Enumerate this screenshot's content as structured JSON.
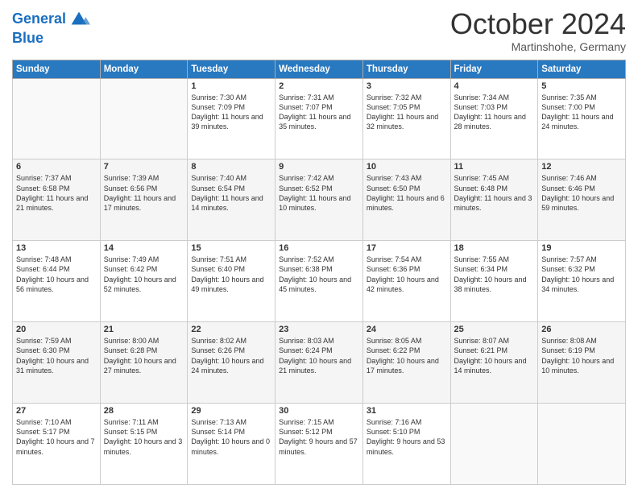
{
  "header": {
    "logo_line1": "General",
    "logo_line2": "Blue",
    "month": "October 2024",
    "location": "Martinshohe, Germany"
  },
  "weekdays": [
    "Sunday",
    "Monday",
    "Tuesday",
    "Wednesday",
    "Thursday",
    "Friday",
    "Saturday"
  ],
  "weeks": [
    [
      {
        "day": "",
        "info": ""
      },
      {
        "day": "",
        "info": ""
      },
      {
        "day": "1",
        "info": "Sunrise: 7:30 AM\nSunset: 7:09 PM\nDaylight: 11 hours and 39 minutes."
      },
      {
        "day": "2",
        "info": "Sunrise: 7:31 AM\nSunset: 7:07 PM\nDaylight: 11 hours and 35 minutes."
      },
      {
        "day": "3",
        "info": "Sunrise: 7:32 AM\nSunset: 7:05 PM\nDaylight: 11 hours and 32 minutes."
      },
      {
        "day": "4",
        "info": "Sunrise: 7:34 AM\nSunset: 7:03 PM\nDaylight: 11 hours and 28 minutes."
      },
      {
        "day": "5",
        "info": "Sunrise: 7:35 AM\nSunset: 7:00 PM\nDaylight: 11 hours and 24 minutes."
      }
    ],
    [
      {
        "day": "6",
        "info": "Sunrise: 7:37 AM\nSunset: 6:58 PM\nDaylight: 11 hours and 21 minutes."
      },
      {
        "day": "7",
        "info": "Sunrise: 7:39 AM\nSunset: 6:56 PM\nDaylight: 11 hours and 17 minutes."
      },
      {
        "day": "8",
        "info": "Sunrise: 7:40 AM\nSunset: 6:54 PM\nDaylight: 11 hours and 14 minutes."
      },
      {
        "day": "9",
        "info": "Sunrise: 7:42 AM\nSunset: 6:52 PM\nDaylight: 11 hours and 10 minutes."
      },
      {
        "day": "10",
        "info": "Sunrise: 7:43 AM\nSunset: 6:50 PM\nDaylight: 11 hours and 6 minutes."
      },
      {
        "day": "11",
        "info": "Sunrise: 7:45 AM\nSunset: 6:48 PM\nDaylight: 11 hours and 3 minutes."
      },
      {
        "day": "12",
        "info": "Sunrise: 7:46 AM\nSunset: 6:46 PM\nDaylight: 10 hours and 59 minutes."
      }
    ],
    [
      {
        "day": "13",
        "info": "Sunrise: 7:48 AM\nSunset: 6:44 PM\nDaylight: 10 hours and 56 minutes."
      },
      {
        "day": "14",
        "info": "Sunrise: 7:49 AM\nSunset: 6:42 PM\nDaylight: 10 hours and 52 minutes."
      },
      {
        "day": "15",
        "info": "Sunrise: 7:51 AM\nSunset: 6:40 PM\nDaylight: 10 hours and 49 minutes."
      },
      {
        "day": "16",
        "info": "Sunrise: 7:52 AM\nSunset: 6:38 PM\nDaylight: 10 hours and 45 minutes."
      },
      {
        "day": "17",
        "info": "Sunrise: 7:54 AM\nSunset: 6:36 PM\nDaylight: 10 hours and 42 minutes."
      },
      {
        "day": "18",
        "info": "Sunrise: 7:55 AM\nSunset: 6:34 PM\nDaylight: 10 hours and 38 minutes."
      },
      {
        "day": "19",
        "info": "Sunrise: 7:57 AM\nSunset: 6:32 PM\nDaylight: 10 hours and 34 minutes."
      }
    ],
    [
      {
        "day": "20",
        "info": "Sunrise: 7:59 AM\nSunset: 6:30 PM\nDaylight: 10 hours and 31 minutes."
      },
      {
        "day": "21",
        "info": "Sunrise: 8:00 AM\nSunset: 6:28 PM\nDaylight: 10 hours and 27 minutes."
      },
      {
        "day": "22",
        "info": "Sunrise: 8:02 AM\nSunset: 6:26 PM\nDaylight: 10 hours and 24 minutes."
      },
      {
        "day": "23",
        "info": "Sunrise: 8:03 AM\nSunset: 6:24 PM\nDaylight: 10 hours and 21 minutes."
      },
      {
        "day": "24",
        "info": "Sunrise: 8:05 AM\nSunset: 6:22 PM\nDaylight: 10 hours and 17 minutes."
      },
      {
        "day": "25",
        "info": "Sunrise: 8:07 AM\nSunset: 6:21 PM\nDaylight: 10 hours and 14 minutes."
      },
      {
        "day": "26",
        "info": "Sunrise: 8:08 AM\nSunset: 6:19 PM\nDaylight: 10 hours and 10 minutes."
      }
    ],
    [
      {
        "day": "27",
        "info": "Sunrise: 7:10 AM\nSunset: 5:17 PM\nDaylight: 10 hours and 7 minutes."
      },
      {
        "day": "28",
        "info": "Sunrise: 7:11 AM\nSunset: 5:15 PM\nDaylight: 10 hours and 3 minutes."
      },
      {
        "day": "29",
        "info": "Sunrise: 7:13 AM\nSunset: 5:14 PM\nDaylight: 10 hours and 0 minutes."
      },
      {
        "day": "30",
        "info": "Sunrise: 7:15 AM\nSunset: 5:12 PM\nDaylight: 9 hours and 57 minutes."
      },
      {
        "day": "31",
        "info": "Sunrise: 7:16 AM\nSunset: 5:10 PM\nDaylight: 9 hours and 53 minutes."
      },
      {
        "day": "",
        "info": ""
      },
      {
        "day": "",
        "info": ""
      }
    ]
  ]
}
